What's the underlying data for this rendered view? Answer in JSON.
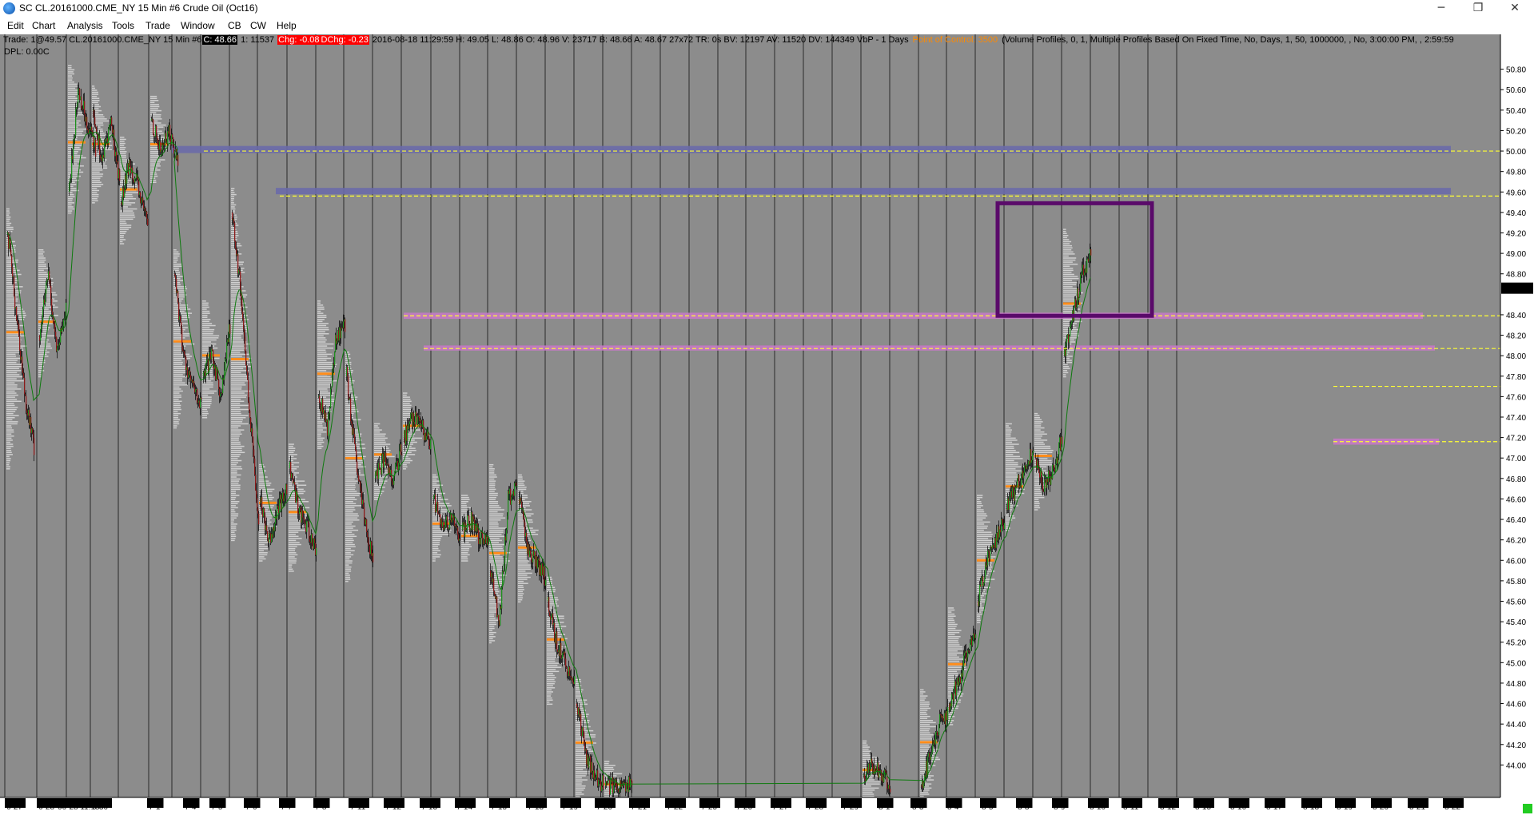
{
  "window": {
    "title": "SC CL.20161000.CME_NY  15 Min  #6  Crude Oil (Oct16)",
    "minimize_glyph": "─",
    "restore_glyph": "❐",
    "close_glyph": "✕"
  },
  "menu": [
    "Edit",
    "Chart",
    "Analysis",
    "Tools",
    "Trade",
    "Window",
    "CB",
    "CW",
    "Help"
  ],
  "infobar": {
    "a": "Trade: 1@49.57  CL.20161000.CME_NY  15 Min  #6",
    "b": "C: 48.66",
    "c": "1: 11537",
    "d": "Chg: -0.08",
    "e": "DChg: -0.23",
    "f": "2016-08-18 11:29:59  H: 49.05  L: 48.86  O: 48.96  V: 23717  B: 48.66  A: 48.67  27x72  TR: 0s  BV: 12197  AV: 11520  DV: 144349  VbP - 1 Days",
    "g": "Point of Control: 3500",
    "h": "(Volume Profiles, 0, 1, Multiple Profiles Based On Fixed Time, No, Days, 1, 50, 1000000, , No, 3:00:00 PM, , 2:59:59"
  },
  "dpl": "DPL: 0.00C",
  "price_axis": {
    "labels": [
      "50.80",
      "50.60",
      "50.40",
      "50.20",
      "50.00",
      "49.80",
      "49.60",
      "49.40",
      "49.20",
      "49.00",
      "48.80",
      "48.66",
      "48.40",
      "48.20",
      "48.00",
      "47.80",
      "47.60",
      "47.40",
      "47.20",
      "47.00",
      "46.80",
      "46.60",
      "46.40",
      "46.20",
      "46.00",
      "45.80",
      "45.60",
      "45.40",
      "45.20",
      "45.00",
      "44.80",
      "44.60",
      "44.40",
      "44.20",
      "44.00"
    ],
    "current_price": "48.66"
  },
  "date_axis": {
    "labels": [
      "6-27",
      "6-28",
      "06-28  11:15",
      "6-30",
      "7-1",
      "7-4",
      "7-5",
      "7-6",
      "7-7",
      "7-8",
      "7-11",
      "7-12",
      "7-13",
      "7-14",
      "7-15",
      "7-18",
      "7-19",
      "7-20",
      "7-21",
      "7-22",
      "7-25",
      "7-26",
      "7-27",
      "7-28",
      "7-29",
      "8-1",
      "8-3",
      "8-4",
      "8-5",
      "8-8",
      "8-9",
      "8-10",
      "8-11",
      "8-12",
      "8-15",
      "8-16",
      "8-17",
      "8-18",
      "8-19",
      "8-20",
      "8-21",
      "8-22"
    ]
  },
  "colors": {
    "chart_bg": "#8c8c8c",
    "up_candle": "#1f8f1f",
    "down_candle": "#8b1a1a",
    "ma_line": "#0d7a0d",
    "blue_zone": "#6a6aa8",
    "pink_zone": "#c878c8",
    "level_line": "#ffff33",
    "box": "#5a0a6a",
    "poc": "#ff8c1a"
  },
  "chart_data": {
    "type": "candlestick",
    "title": "Crude Oil (Oct16) 15 Min",
    "ylim": [
      43.8,
      51.0
    ],
    "levels": [
      50.0,
      49.56,
      48.39,
      48.07,
      47.7,
      47.16
    ],
    "blue_zones": [
      [
        49.98,
        50.05
      ],
      [
        49.58,
        49.64
      ]
    ],
    "pink_zones": [
      [
        48.36,
        48.42
      ],
      [
        48.05,
        48.1
      ],
      [
        47.13,
        47.19
      ]
    ],
    "box": {
      "from": "8-16",
      "to": "8-21",
      "high": 49.49,
      "low": 48.39
    },
    "path": [
      [
        "6-27",
        49.2,
        48.4,
        47.6,
        47.1
      ],
      [
        "6-28",
        48.2,
        48.8,
        48.0,
        48.5
      ],
      [
        "6-29",
        49.6,
        50.6,
        50.3,
        50.0
      ],
      [
        "6-30",
        50.4,
        49.9,
        50.3,
        49.7
      ],
      [
        "7-1",
        49.5,
        49.9,
        49.6,
        49.3
      ],
      [
        "7-4",
        50.3,
        50.0,
        50.2,
        49.9
      ],
      [
        "7-5",
        48.8,
        48.0,
        47.7,
        47.5
      ],
      [
        "7-6",
        47.8,
        48.0,
        47.6,
        48.3
      ],
      [
        "7-7",
        49.4,
        48.6,
        47.4,
        46.4
      ],
      [
        "7-8",
        46.6,
        46.2,
        46.5,
        46.7
      ],
      [
        "7-11",
        46.9,
        46.5,
        46.3,
        46.1
      ],
      [
        "7-12",
        47.6,
        47.3,
        48.2,
        48.3
      ],
      [
        "7-13",
        47.8,
        47.0,
        46.4,
        46.0
      ],
      [
        "7-14",
        46.8,
        47.0,
        46.8,
        47.1
      ],
      [
        "7-15",
        47.2,
        47.4,
        47.3,
        47.1
      ],
      [
        "7-18",
        46.6,
        46.3,
        46.4,
        46.2
      ],
      [
        "7-19",
        46.3,
        46.4,
        46.2,
        46.2
      ],
      [
        "7-20",
        45.9,
        45.4,
        46.6,
        46.7
      ],
      [
        "7-21",
        46.6,
        46.1,
        46.0,
        45.8
      ],
      [
        "7-22",
        45.6,
        45.2,
        45.0,
        44.8
      ],
      [
        "7-25",
        44.6,
        44.1,
        43.9,
        43.8
      ],
      [
        "7-26",
        43.8,
        43.8,
        43.8,
        43.8
      ],
      [
        "8-9",
        43.9,
        44.0,
        43.9,
        43.8
      ],
      [
        "8-11",
        43.8,
        44.1,
        44.4,
        44.5
      ],
      [
        "8-12",
        44.6,
        44.8,
        45.1,
        45.3
      ],
      [
        "8-15",
        45.6,
        46.0,
        46.2,
        46.4
      ],
      [
        "8-16",
        46.5,
        46.7,
        46.9,
        47.1
      ],
      [
        "8-17",
        47.0,
        46.7,
        46.9,
        47.2
      ],
      [
        "8-18",
        48.0,
        48.4,
        48.8,
        49.0
      ]
    ]
  }
}
